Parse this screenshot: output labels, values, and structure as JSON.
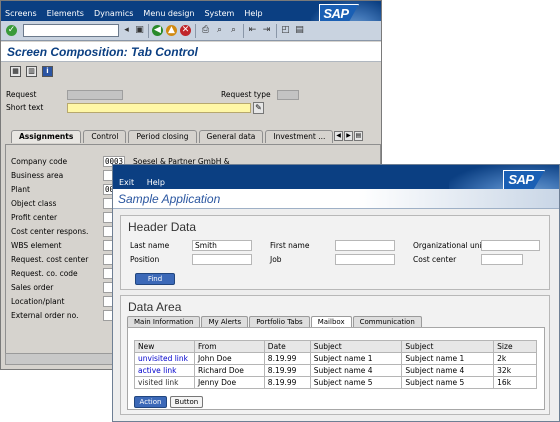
{
  "gui": {
    "menu": [
      "Screens",
      "Elements",
      "Dynamics",
      "Menu design",
      "System",
      "Help"
    ],
    "logo": "SAP",
    "title": "Screen Composition: Tab Control",
    "header": {
      "request_label": "Request",
      "request_type_label": "Request type",
      "short_text_label": "Short text"
    },
    "tabs": [
      "Assignments",
      "Control",
      "Period closing",
      "General data",
      "Investment ..."
    ],
    "fields": [
      {
        "label": "Company code",
        "value": "0003",
        "text": "Soesel & Partner GmbH &"
      },
      {
        "label": "Business area",
        "value": "",
        "text": ""
      },
      {
        "label": "Plant",
        "value": "00",
        "text": ""
      },
      {
        "label": "Object class",
        "value": "",
        "text": ""
      },
      {
        "label": "Profit center",
        "value": "",
        "text": ""
      },
      {
        "label": "Cost center respons.",
        "value": "",
        "text": ""
      },
      {
        "label": "WBS element",
        "value": "",
        "text": ""
      },
      {
        "label": "Request. cost center",
        "value": "",
        "text": ""
      },
      {
        "label": "Request. co. code",
        "value": "",
        "text": ""
      },
      {
        "label": "Sales order",
        "value": "",
        "text": ""
      },
      {
        "label": "Location/plant",
        "value": "",
        "text": ""
      },
      {
        "label": "External order no.",
        "value": "",
        "text": ""
      }
    ]
  },
  "web": {
    "menu": [
      "Exit",
      "Help"
    ],
    "logo": "SAP",
    "app_title": "Sample Application",
    "header_data": {
      "heading": "Header Data",
      "last_name_label": "Last name",
      "last_name_value": "Smith",
      "first_name_label": "First name",
      "first_name_value": "",
      "org_unit_label": "Organizational unit",
      "org_unit_value": "",
      "position_label": "Position",
      "position_value": "",
      "job_label": "Job",
      "job_value": "",
      "cost_center_label": "Cost center",
      "cost_center_value": "",
      "find_button": "Find"
    },
    "data_area": {
      "heading": "Data Area",
      "tabs": [
        "Main Information",
        "My Alerts",
        "Portfolio Tabs",
        "Mailbox",
        "Communication"
      ],
      "active_tab": "Mailbox",
      "columns": [
        "New",
        "From",
        "Date",
        "Subject",
        "Subject",
        "Size"
      ],
      "rows": [
        {
          "new": "unvisited link",
          "from": "John Doe",
          "date": "8.19.99",
          "subject1": "Subject name 1",
          "subject2": "Subject name 1",
          "size": "2k"
        },
        {
          "new": "active link",
          "from": "Richard Doe",
          "date": "8.19.99",
          "subject1": "Subject name 4",
          "subject2": "Subject name 4",
          "size": "32k"
        },
        {
          "new": "visited link",
          "from": "Jenny Doe",
          "date": "8.19.99",
          "subject1": "Subject name 5",
          "subject2": "Subject name 5",
          "size": "16k"
        }
      ],
      "action_button": "Action",
      "button_label": "Button"
    }
  },
  "colors": {
    "sap_blue": "#0b3f82",
    "title_blue": "#2a56a0",
    "button_blue": "#3c69b8",
    "short_text_yellow": "#fff7a6"
  }
}
